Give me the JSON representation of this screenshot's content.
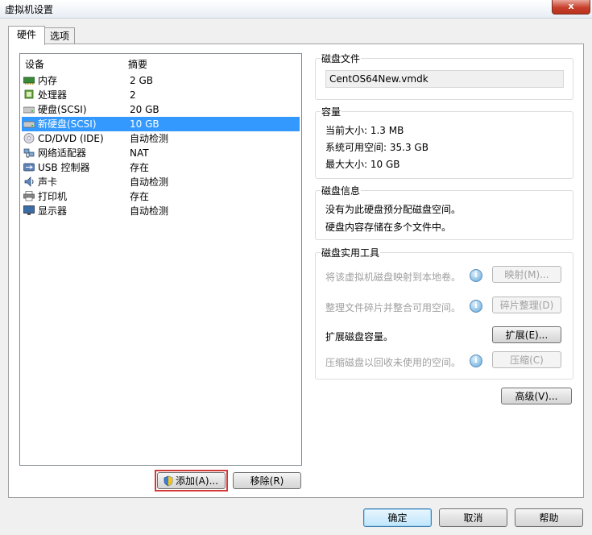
{
  "window": {
    "title": "虚拟机设置",
    "close_label": "x"
  },
  "tabs": [
    {
      "label": "硬件",
      "active": true
    },
    {
      "label": "选项",
      "active": false
    }
  ],
  "device_list": {
    "headers": {
      "device": "设备",
      "summary": "摘要"
    },
    "rows": [
      {
        "name": "内存",
        "summary": "2 GB",
        "icon": "memory-icon"
      },
      {
        "name": "处理器",
        "summary": "2",
        "icon": "processor-icon"
      },
      {
        "name": "硬盘(SCSI)",
        "summary": "20 GB",
        "icon": "hard-disk-icon"
      },
      {
        "name": "新硬盘(SCSI)",
        "summary": "10 GB",
        "icon": "hard-disk-icon",
        "selected": true
      },
      {
        "name": "CD/DVD (IDE)",
        "summary": "自动检测",
        "icon": "cd-dvd-icon"
      },
      {
        "name": "网络适配器",
        "summary": "NAT",
        "icon": "network-adapter-icon"
      },
      {
        "name": "USB 控制器",
        "summary": "存在",
        "icon": "usb-icon"
      },
      {
        "name": "声卡",
        "summary": "自动检测",
        "icon": "sound-card-icon"
      },
      {
        "name": "打印机",
        "summary": "存在",
        "icon": "printer-icon"
      },
      {
        "name": "显示器",
        "summary": "自动检测",
        "icon": "display-icon"
      }
    ]
  },
  "disk_file": {
    "title": "磁盘文件",
    "value": "CentOS64New.vmdk"
  },
  "capacity": {
    "title": "容量",
    "current_size": "当前大小: 1.3 MB",
    "free_space": "系统可用空间: 35.3 GB",
    "max_size": "最大大小: 10 GB"
  },
  "disk_info": {
    "title": "磁盘信息",
    "line1": "没有为此硬盘预分配磁盘空间。",
    "line2": "硬盘内容存储在多个文件中。"
  },
  "utilities": {
    "title": "磁盘实用工具",
    "map_text": "将该虚拟机磁盘映射到本地卷。",
    "map_button": "映射(M)...",
    "defrag_text": "整理文件碎片并整合可用空间。",
    "defrag_button": "碎片整理(D)",
    "expand_text": "扩展磁盘容量。",
    "expand_button": "扩展(E)...",
    "compact_text": "压缩磁盘以回收未使用的空间。",
    "compact_button": "压缩(C)"
  },
  "advanced_button": "高级(V)...",
  "add_button": "添加(A)...",
  "remove_button": "移除(R)",
  "footer": {
    "ok": "确定",
    "cancel": "取消",
    "help": "帮助"
  },
  "colors": {
    "selection": "#3399ff",
    "highlight_box": "#d23a3a"
  }
}
